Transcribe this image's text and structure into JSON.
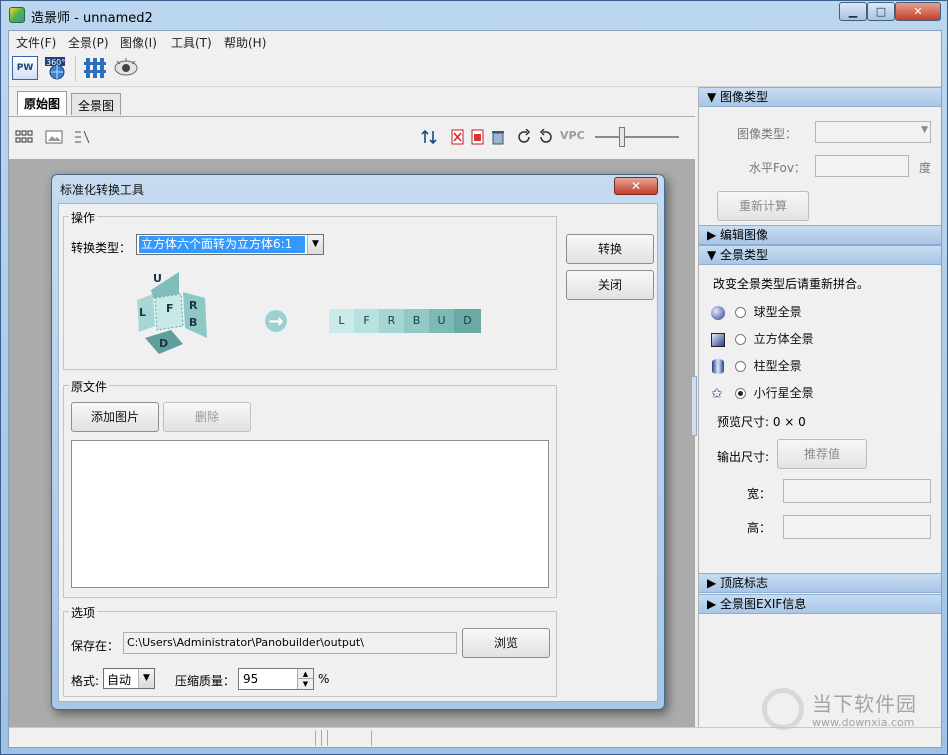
{
  "window": {
    "title": "造景师 - unnamed2",
    "min": "▁",
    "max": "□",
    "close": "✕"
  },
  "menu": [
    "文件(F)",
    "全景(P)",
    "图像(I)",
    "工具(T)",
    "帮助(H)"
  ],
  "toolbar": {
    "icons": [
      "pw-icon",
      "360-globe-icon",
      "grid-icon",
      "eye-icon"
    ],
    "pw_label": "PW",
    "b360_label": "360°"
  },
  "tabs": [
    "原始图",
    "全景图"
  ],
  "viewbar": {
    "vpc_label": "VPC"
  },
  "right_panel": {
    "image_type_header": "图像类型",
    "image_type_label": "图像类型：",
    "hfov_label": "水平Fov：",
    "degree_unit": "度",
    "recalc_button": "重新计算",
    "edit_image_header": "编辑图像",
    "pano_type_header": "全景类型",
    "pano_note": "改变全景类型后请重新拼合。",
    "pano_options": [
      "球型全景",
      "立方体全景",
      "柱型全景",
      "小行星全景"
    ],
    "preview_size": "预览尺寸: 0 × 0",
    "output_size_label": "输出尺寸:",
    "recommend_button": "推荐值",
    "width_label": "宽：",
    "height_label": "高：",
    "top_bottom_header": "顶底标志",
    "exif_header": "全景图EXIF信息"
  },
  "dialog": {
    "title": "标准化转换工具",
    "close": "✕",
    "ops_group": "操作",
    "convert_type_label": "转换类型：",
    "convert_type_value": "立方体六个面转为立方体6:1",
    "convert_button": "转换",
    "close_button": "关闭",
    "cube_faces": {
      "u": "U",
      "l": "L",
      "f": "F",
      "r": "R",
      "b": "B",
      "d": "D"
    },
    "strip_faces": [
      "L",
      "F",
      "R",
      "B",
      "U",
      "D"
    ],
    "source_group": "原文件",
    "add_image_button": "添加图片",
    "delete_button": "删除",
    "options_group": "选项",
    "save_label": "保存在：",
    "save_path": "C:\\Users\\Administrator\\Panobuilder\\output\\",
    "browse_button": "浏览",
    "format_label": "格式:",
    "format_value": "自动",
    "quality_label": "压缩质量：",
    "quality_value": "95",
    "percent": "%"
  },
  "watermark": {
    "text": "当下软件园",
    "url": "www.downxia.com"
  }
}
